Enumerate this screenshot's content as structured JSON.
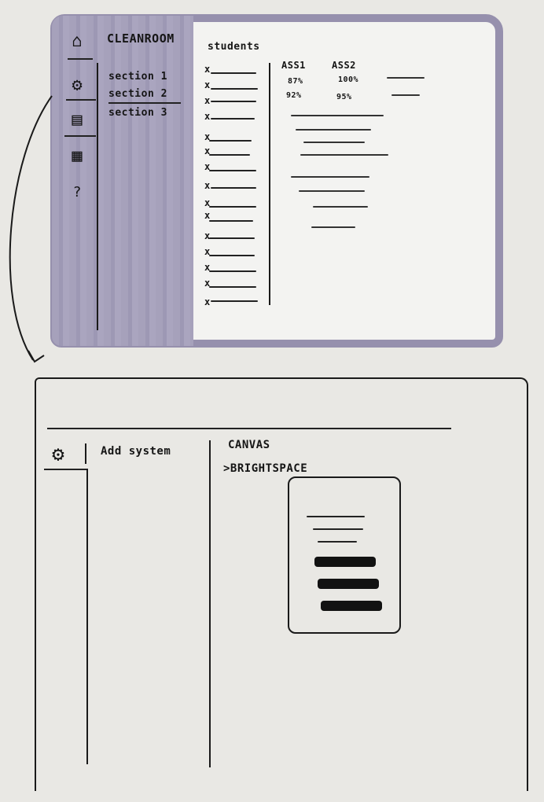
{
  "sketch1": {
    "app_title": "CLEANROOM",
    "sidebar_sections": [
      "section 1",
      "section 2",
      "section 3"
    ],
    "rail_icons": [
      "home-icon",
      "gear-icon",
      "notebook-icon",
      "calendar-icon",
      "help-icon"
    ],
    "students_label": "students",
    "student_marker": "x",
    "columns": [
      "ASS1",
      "ASS2"
    ],
    "grades": [
      [
        "87%",
        "100%"
      ],
      [
        "92%",
        "95%"
      ]
    ],
    "colors": {
      "sidebar": "#a39eb9",
      "frame": "#9690ad"
    }
  },
  "sketch2": {
    "menu_item": "Add system",
    "systems": [
      "CANVAS",
      ">BRIGHTSPACE"
    ],
    "rail_icon": "gear-icon"
  }
}
